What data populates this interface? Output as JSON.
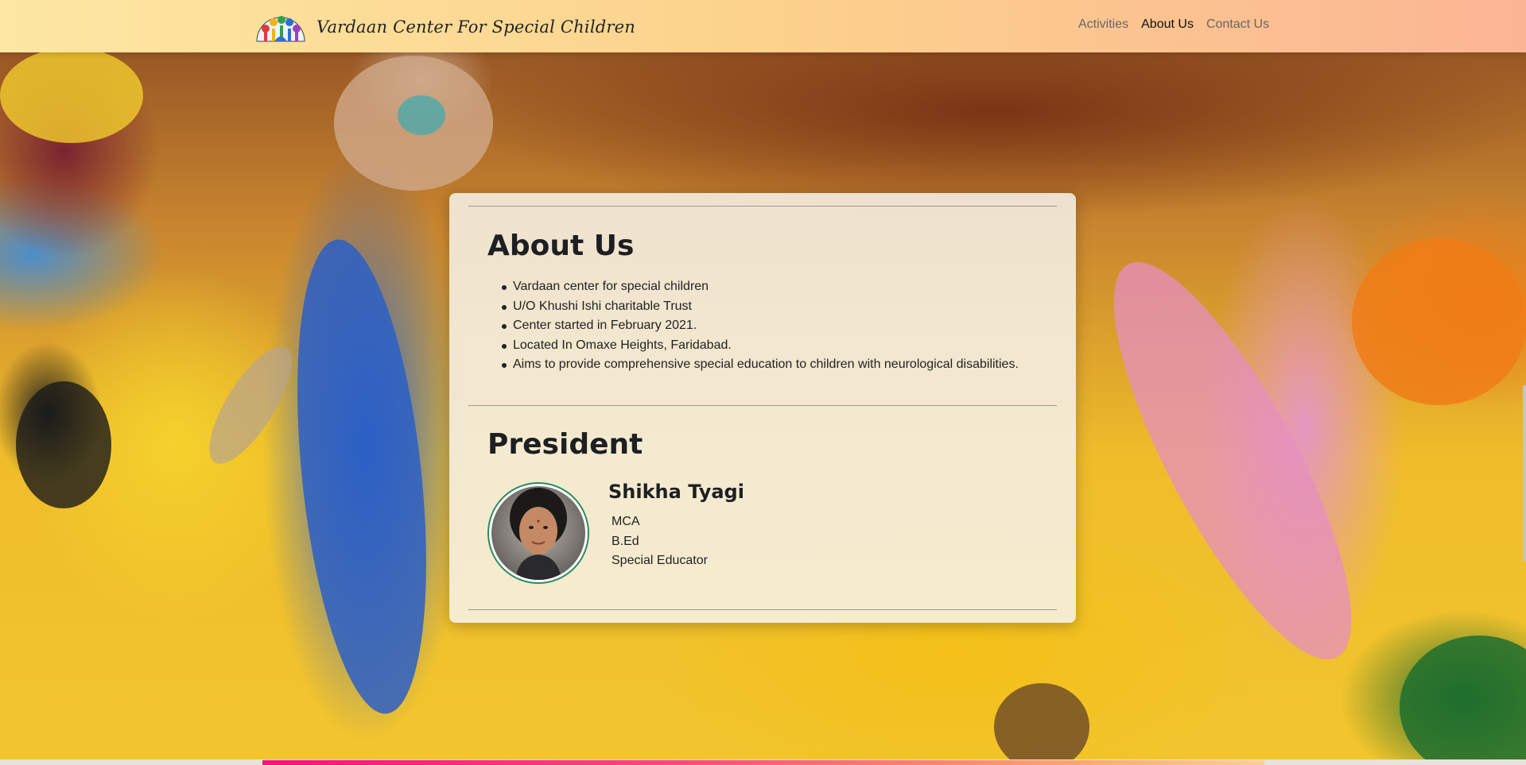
{
  "navbar": {
    "brand_name": "Vardaan Center For Special Children",
    "logo_icon": "hands-tree-logo-icon",
    "links": [
      {
        "label": "Activities",
        "active": false
      },
      {
        "label": "About Us",
        "active": true
      },
      {
        "label": "Contact Us",
        "active": false
      }
    ]
  },
  "about": {
    "title": "About Us",
    "items": [
      "Vardaan center for special children",
      "U/O Khushi Ishi charitable Trust",
      "Center started in February 2021.",
      "Located In Omaxe Heights, Faridabad.",
      "Aims to provide comprehensive special education to children with neurological disabilities."
    ]
  },
  "president": {
    "title": "President",
    "name": "Shikha Tyagi",
    "qualifications": [
      "MCA",
      "B.Ed",
      "Special Educator"
    ]
  },
  "colors": {
    "nav_gradient_start": "#fde7a3",
    "nav_gradient_end": "#fbb594",
    "accent_line_start": "#f0157c",
    "avatar_border": "#2c8a5c"
  }
}
